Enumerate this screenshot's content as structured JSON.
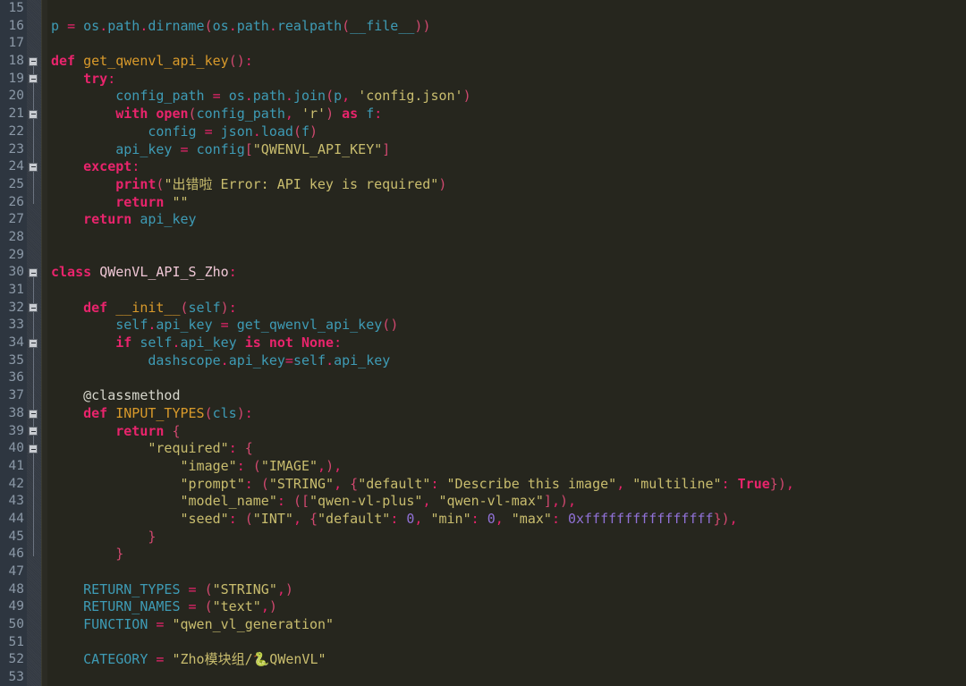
{
  "editor": {
    "name": "code-editor",
    "language": "Python",
    "first_visible_line": 15,
    "last_visible_line": 53,
    "line_height_px": 19.7,
    "colors": {
      "background": "#26261e",
      "gutter_background": "#2e3640",
      "line_number": "#8b98a6",
      "keyword": "#e8246c",
      "function": "#d99a2b",
      "class_name": "#f0c7d6",
      "identifier": "#3e9bb5",
      "string": "#c9bd6e",
      "number": "#9071d6",
      "operator": "#e8246c",
      "decorator": "#d7d7cd"
    }
  },
  "gutter": {
    "line_numbers": [
      "15",
      "16",
      "17",
      "18",
      "19",
      "20",
      "21",
      "22",
      "23",
      "24",
      "25",
      "26",
      "27",
      "28",
      "29",
      "30",
      "31",
      "32",
      "33",
      "34",
      "35",
      "36",
      "37",
      "38",
      "39",
      "40",
      "41",
      "42",
      "43",
      "44",
      "45",
      "46",
      "47",
      "48",
      "49",
      "50",
      "51",
      "52",
      "53"
    ],
    "fold_markers": [
      {
        "line": 18,
        "state": "expanded",
        "icon": "fold-minus-icon"
      },
      {
        "line": 19,
        "state": "expanded",
        "icon": "fold-minus-icon"
      },
      {
        "line": 21,
        "state": "expanded",
        "icon": "fold-minus-icon"
      },
      {
        "line": 24,
        "state": "expanded",
        "icon": "fold-minus-icon"
      },
      {
        "line": 30,
        "state": "expanded",
        "icon": "fold-minus-icon"
      },
      {
        "line": 32,
        "state": "expanded",
        "icon": "fold-minus-icon"
      },
      {
        "line": 34,
        "state": "expanded",
        "icon": "fold-minus-icon"
      },
      {
        "line": 38,
        "state": "expanded",
        "icon": "fold-minus-icon"
      },
      {
        "line": 39,
        "state": "expanded",
        "icon": "fold-minus-icon"
      },
      {
        "line": 40,
        "state": "expanded",
        "icon": "fold-minus-icon"
      }
    ]
  },
  "code": {
    "lines": [
      {
        "n": 15,
        "text": ""
      },
      {
        "n": 16,
        "text": "p = os.path.dirname(os.path.realpath(__file__))"
      },
      {
        "n": 17,
        "text": ""
      },
      {
        "n": 18,
        "text": "def get_qwenvl_api_key():"
      },
      {
        "n": 19,
        "text": "    try:"
      },
      {
        "n": 20,
        "text": "        config_path = os.path.join(p, 'config.json')"
      },
      {
        "n": 21,
        "text": "        with open(config_path, 'r') as f:"
      },
      {
        "n": 22,
        "text": "            config = json.load(f)"
      },
      {
        "n": 23,
        "text": "        api_key = config[\"QWENVL_API_KEY\"]"
      },
      {
        "n": 24,
        "text": "    except:"
      },
      {
        "n": 25,
        "text": "        print(\"出错啦 Error: API key is required\")"
      },
      {
        "n": 26,
        "text": "        return \"\""
      },
      {
        "n": 27,
        "text": "    return api_key"
      },
      {
        "n": 28,
        "text": ""
      },
      {
        "n": 29,
        "text": ""
      },
      {
        "n": 30,
        "text": "class QWenVL_API_S_Zho:"
      },
      {
        "n": 31,
        "text": ""
      },
      {
        "n": 32,
        "text": "    def __init__(self):"
      },
      {
        "n": 33,
        "text": "        self.api_key = get_qwenvl_api_key()"
      },
      {
        "n": 34,
        "text": "        if self.api_key is not None:"
      },
      {
        "n": 35,
        "text": "            dashscope.api_key=self.api_key"
      },
      {
        "n": 36,
        "text": ""
      },
      {
        "n": 37,
        "text": "    @classmethod"
      },
      {
        "n": 38,
        "text": "    def INPUT_TYPES(cls):"
      },
      {
        "n": 39,
        "text": "        return {"
      },
      {
        "n": 40,
        "text": "            \"required\": {"
      },
      {
        "n": 41,
        "text": "                \"image\": (\"IMAGE\",),"
      },
      {
        "n": 42,
        "text": "                \"prompt\": (\"STRING\", {\"default\": \"Describe this image\", \"multiline\": True}),"
      },
      {
        "n": 43,
        "text": "                \"model_name\": ([\"qwen-vl-plus\", \"qwen-vl-max\"],),"
      },
      {
        "n": 44,
        "text": "                \"seed\": (\"INT\", {\"default\": 0, \"min\": 0, \"max\": 0xffffffffffffffff}),"
      },
      {
        "n": 45,
        "text": "            }"
      },
      {
        "n": 46,
        "text": "        }"
      },
      {
        "n": 47,
        "text": ""
      },
      {
        "n": 48,
        "text": "    RETURN_TYPES = (\"STRING\",)"
      },
      {
        "n": 49,
        "text": "    RETURN_NAMES = (\"text\",)"
      },
      {
        "n": 50,
        "text": "    FUNCTION = \"qwen_vl_generation\""
      },
      {
        "n": 51,
        "text": ""
      },
      {
        "n": 52,
        "text": "    CATEGORY = \"Zho模块组/🐍QWenVL\""
      },
      {
        "n": 53,
        "text": ""
      }
    ]
  }
}
